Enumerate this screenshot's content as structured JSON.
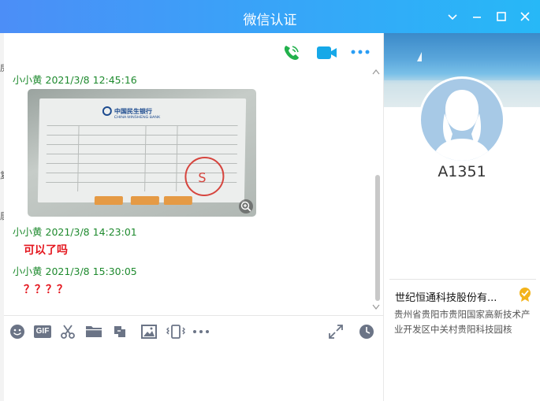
{
  "window": {
    "title": "微信认证"
  },
  "left_edge": [
    "房",
    "复",
    "居"
  ],
  "chat": {
    "messages": [
      {
        "sender": "小小黄",
        "time": "2021/3/8 12:45:16",
        "type": "image"
      },
      {
        "sender": "小小黄",
        "time": "2021/3/8 14:23:01",
        "type": "text",
        "text": "可以了吗"
      },
      {
        "sender": "小小黄",
        "time": "2021/3/8 15:30:05",
        "type": "text",
        "text": "？？？？"
      }
    ],
    "image": {
      "bank_name": "中国民生银行",
      "bank_name_en": "CHINA MINSHENG BANK"
    }
  },
  "toolbar": {
    "icons": [
      "emoji-icon",
      "gif-icon",
      "scissors-icon",
      "folder-icon",
      "rotate-icon",
      "image-icon",
      "phone-vibrate-icon",
      "more-icon"
    ],
    "gif_label": "GIF"
  },
  "sidebar": {
    "contact_name": "A1351",
    "company": "世纪恒通科技股份有...",
    "address": "贵州省贵阳市贵阳国家高新技术产业开发区中关村贵阳科技园核"
  },
  "colors": {
    "title_bar_start": "#4c8ef7",
    "title_bar_end": "#27b8f7",
    "sender": "#1e8a2e",
    "message": "#e4151d",
    "accent": "#2a9df4"
  }
}
